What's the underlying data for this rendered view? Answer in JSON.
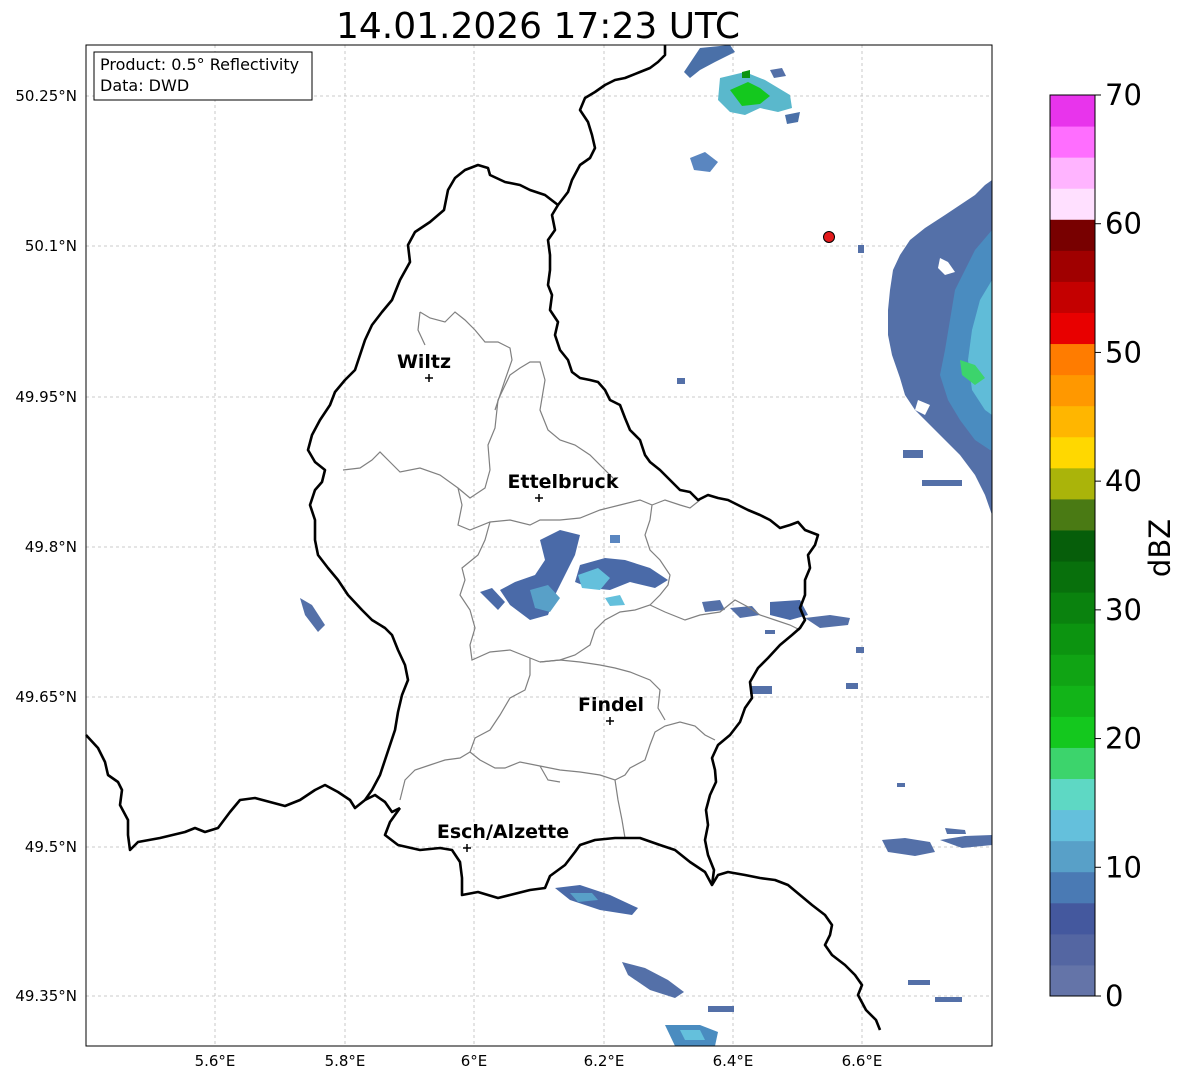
{
  "title": "14.01.2026 17:23 UTC",
  "info_box": {
    "product": "Product: 0.5° Reflectivity",
    "data_source": "Data: DWD"
  },
  "axes": {
    "x_ticks": [
      "5.6°E",
      "5.8°E",
      "6°E",
      "6.2°E",
      "6.4°E",
      "6.6°E"
    ],
    "y_ticks": [
      "50.25°N",
      "50.1°N",
      "49.95°N",
      "49.8°N",
      "49.65°N",
      "49.5°N",
      "49.35°N"
    ],
    "gridlines": true
  },
  "cities": [
    {
      "name": "Wiltz"
    },
    {
      "name": "Ettelbruck"
    },
    {
      "name": "Findel"
    },
    {
      "name": "Esch/Alzette"
    }
  ],
  "radar_site_marker": {
    "color": "#e31a1c"
  },
  "colorbar": {
    "label": "dBZ",
    "tick_labels": [
      "0",
      "10",
      "20",
      "30",
      "40",
      "50",
      "60",
      "70"
    ],
    "colors": [
      "#6474a8",
      "#5466a2",
      "#44589e",
      "#4a7ab4",
      "#58a0c8",
      "#64c0dc",
      "#5ed8c4",
      "#3cd46c",
      "#14c81e",
      "#12b418",
      "#10a414",
      "#0c9410",
      "#0a820e",
      "#08700c",
      "#065e0a",
      "#4a7a14",
      "#aab40a",
      "#ffd800",
      "#ffb600",
      "#ff9800",
      "#ff7c00",
      "#e80000",
      "#c40000",
      "#a00000",
      "#780000",
      "#ffe0ff",
      "#ffb4ff",
      "#ff6eff",
      "#e834ec"
    ]
  },
  "chart_data": {
    "type": "map",
    "title": "14.01.2026 17:23 UTC",
    "xlim_lon": [
      5.4,
      6.8
    ],
    "ylim_lat": [
      49.3,
      50.3
    ],
    "units": "dBZ",
    "color_range": [
      0,
      70
    ]
  }
}
